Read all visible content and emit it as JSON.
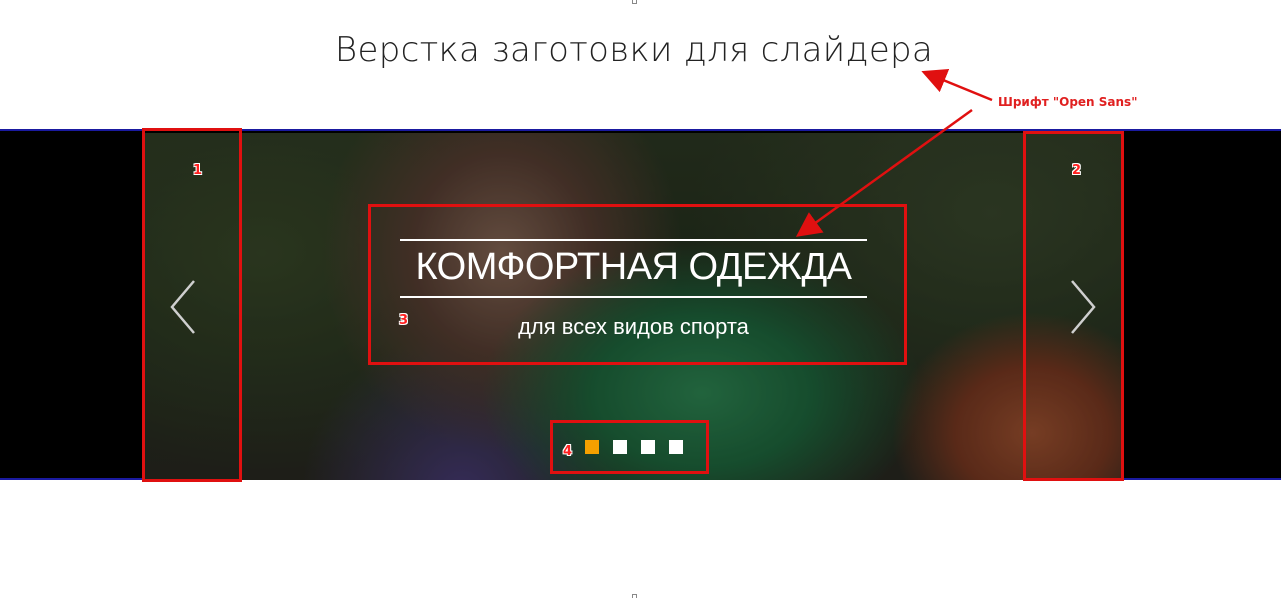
{
  "page": {
    "title": "Верстка заготовки для слайдера"
  },
  "annotation": {
    "font_note": "Шрифт \"Open Sans\"",
    "color": "#e01010",
    "labels": [
      "1",
      "2",
      "3",
      "4"
    ]
  },
  "slider": {
    "heading": "КОМФОРТНАЯ ОДЕЖДА",
    "subheading": "для всех видов спорта",
    "prev_icon": "chevron-left-icon",
    "next_icon": "chevron-right-icon",
    "dots_count": 4,
    "active_dot": 0,
    "active_dot_color": "#f5a000",
    "band_color": "#000000",
    "border_color": "#1a1aa0"
  }
}
